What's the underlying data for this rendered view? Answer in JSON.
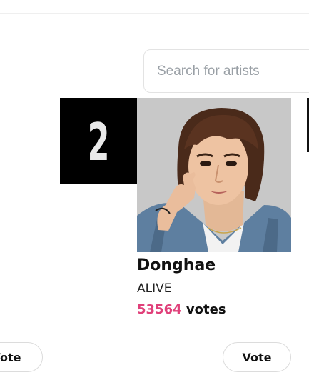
{
  "search": {
    "placeholder": "Search for artists",
    "value": ""
  },
  "artist_card": {
    "rank": "2",
    "name": "Donghae",
    "group": "ALIVE",
    "vote_count": "53564",
    "votes_unit": "votes",
    "vote_button_label": "Vote"
  },
  "adjacent_card": {
    "vote_button_label": "Vote"
  },
  "colors": {
    "vote_count": "#e0407a",
    "rank_bg": "#000000",
    "rank_text": "#e9e9e9"
  },
  "icons": {
    "artist_photo": "artist-photo"
  }
}
